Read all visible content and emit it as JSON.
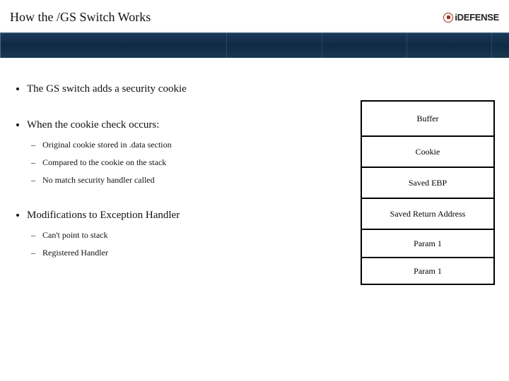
{
  "header": {
    "title": "How the /GS Switch Works",
    "logo_text": "iDEFENSE"
  },
  "bullets": {
    "b1": "The GS switch adds a security cookie",
    "b2": "When the cookie check occurs:",
    "b2_sub": {
      "s1": "Original cookie stored in .data section",
      "s2": "Compared to the cookie on the stack",
      "s3": "No match security handler called"
    },
    "b3": "Modifications to Exception Handler",
    "b3_sub": {
      "s1": "Can't point to stack",
      "s2": "Registered Handler"
    }
  },
  "stack": {
    "r1": "Buffer",
    "r2": "Cookie",
    "r3": "Saved EBP",
    "r4": "Saved Return Address",
    "r5": "Param 1",
    "r6": "Param 1"
  }
}
